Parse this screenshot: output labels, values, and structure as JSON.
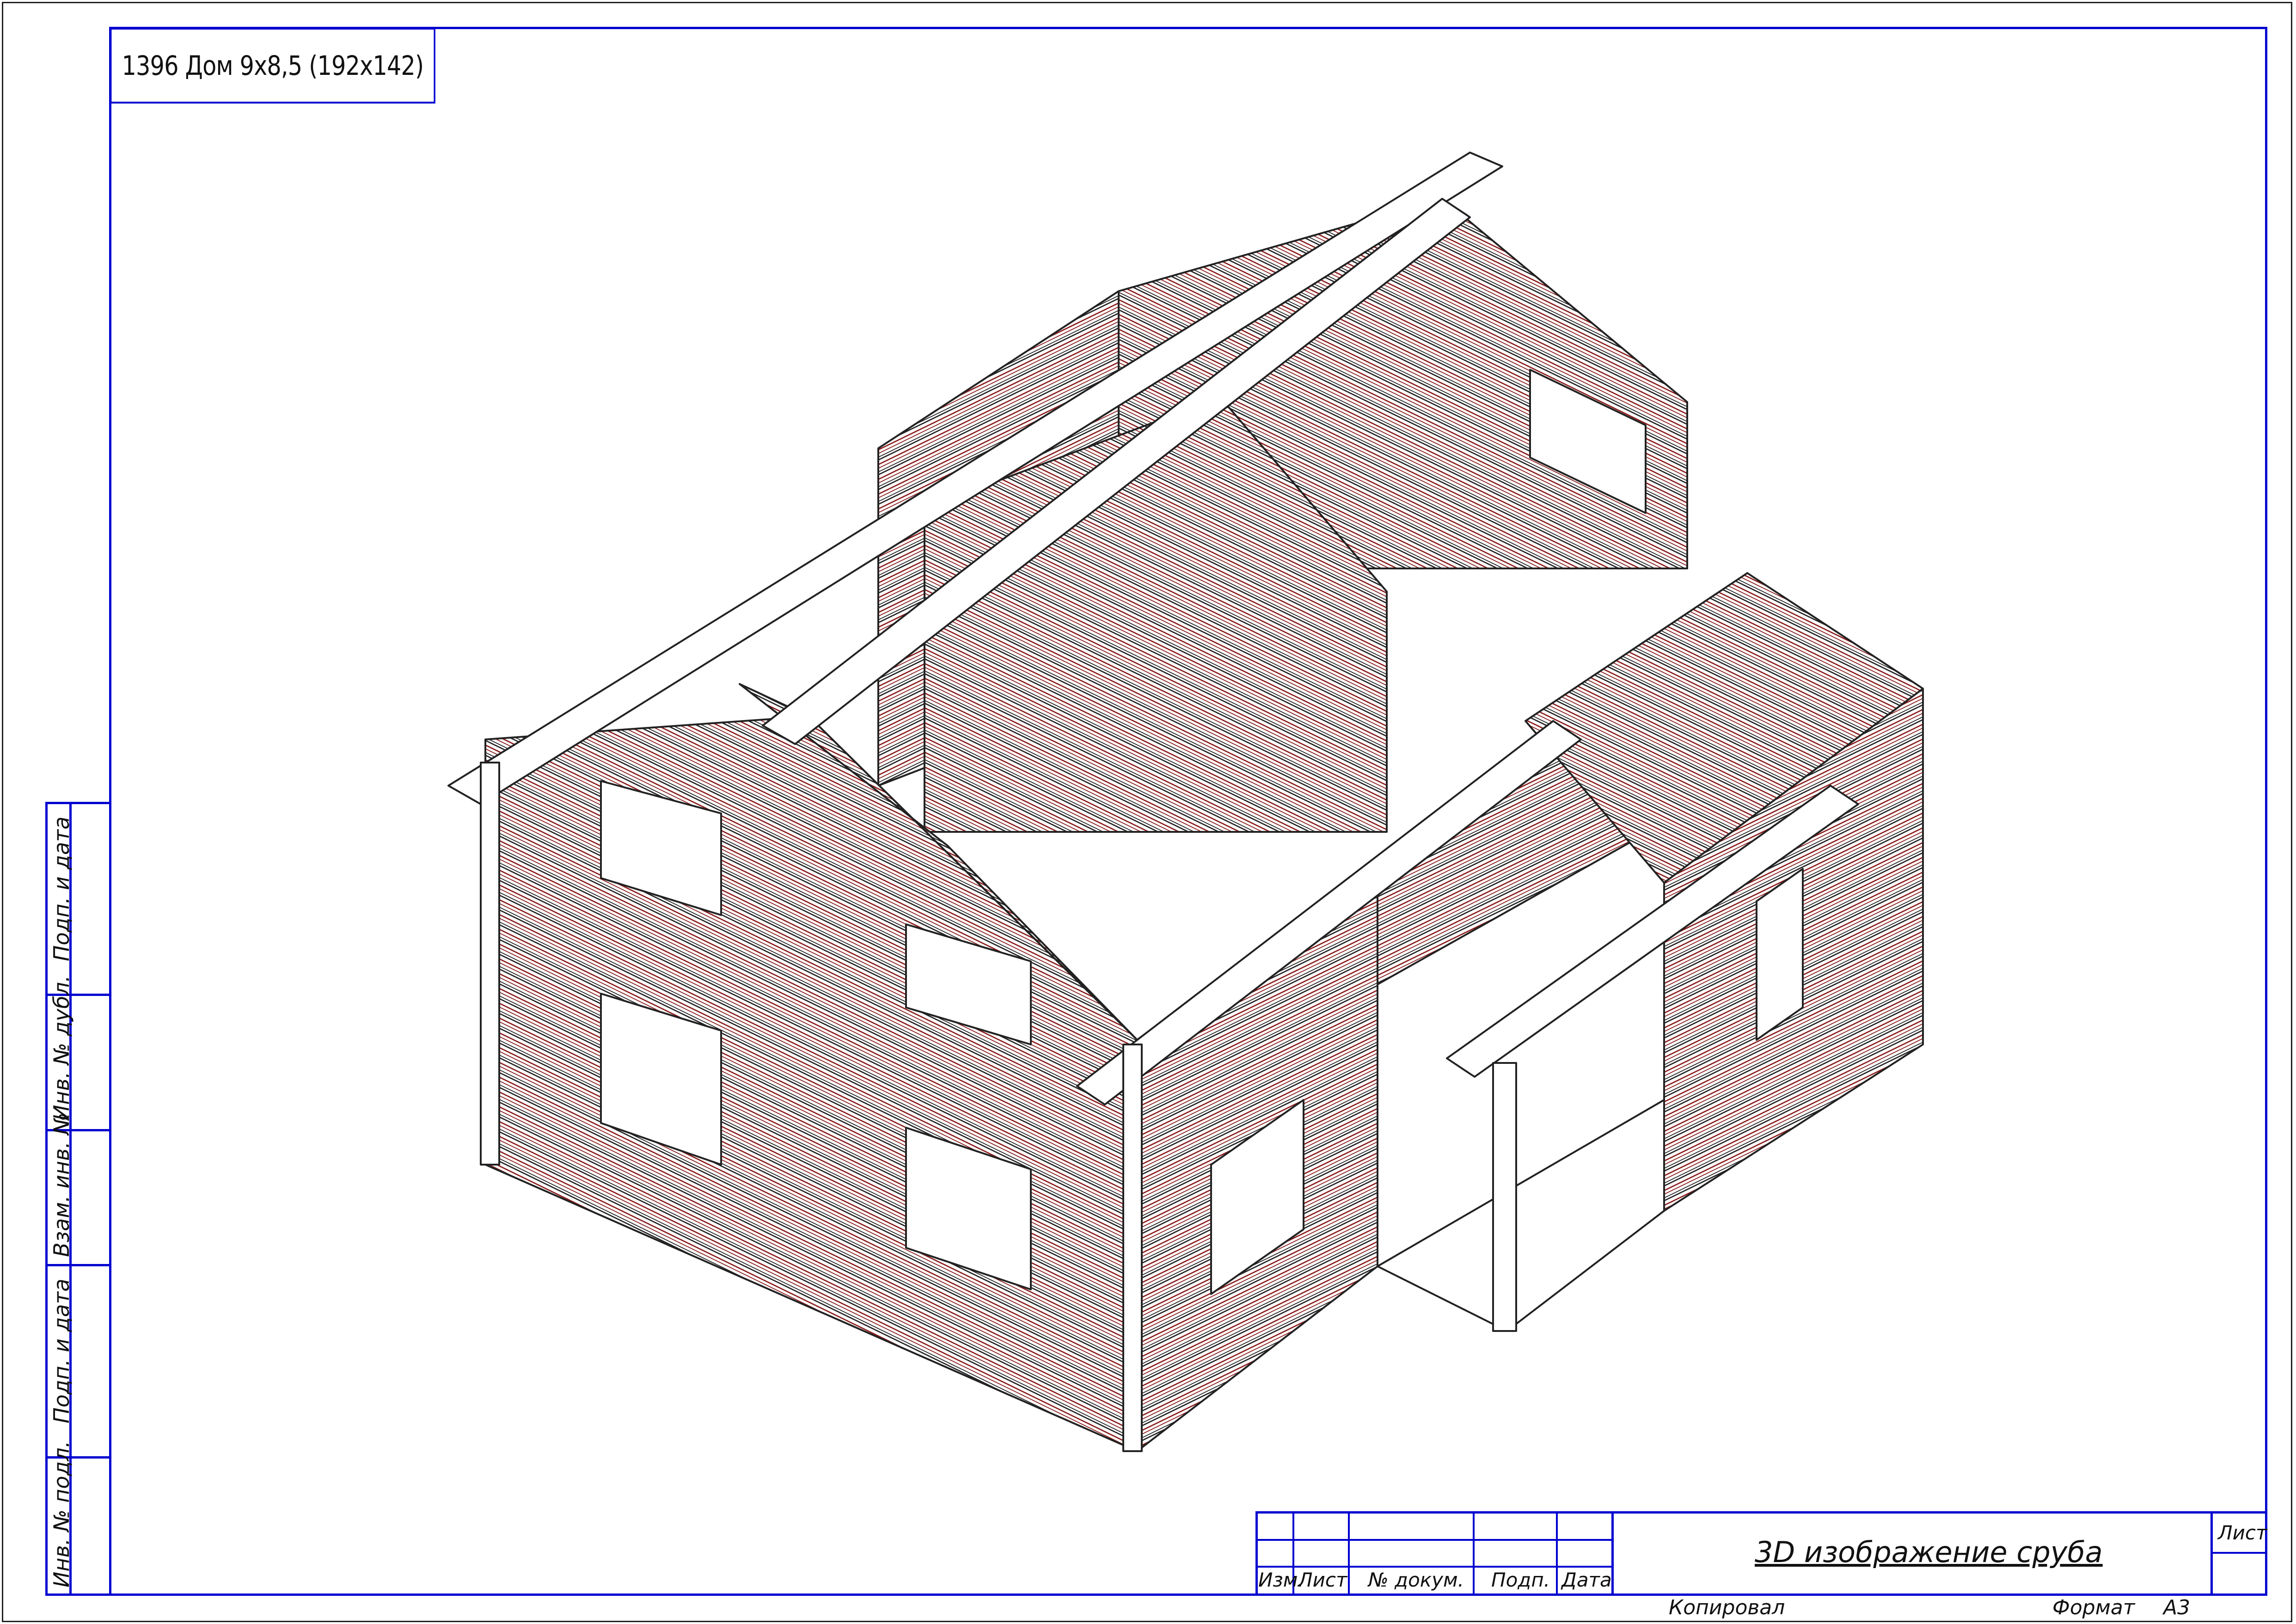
{
  "project_label": "1396 Дом 9х8,5 (192х142)",
  "stamp": {
    "title": "3D изображение сруба",
    "sheet_label": "Лист",
    "columns": [
      "Изм.",
      "Лист",
      "№ докум.",
      "Подп.",
      "Дата"
    ]
  },
  "footer": {
    "copied_label": "Копировал",
    "format_label": "Формат",
    "format_value": "А3"
  },
  "side_stamp": [
    "Подп. и дата",
    "Инв. № дубл.",
    "Взам. инв. №",
    "Подп. и дата",
    "Инв. № подл."
  ],
  "colors": {
    "frame": "#0000d0",
    "lines": "#222222",
    "timber_accent": "#8a1a1a"
  }
}
